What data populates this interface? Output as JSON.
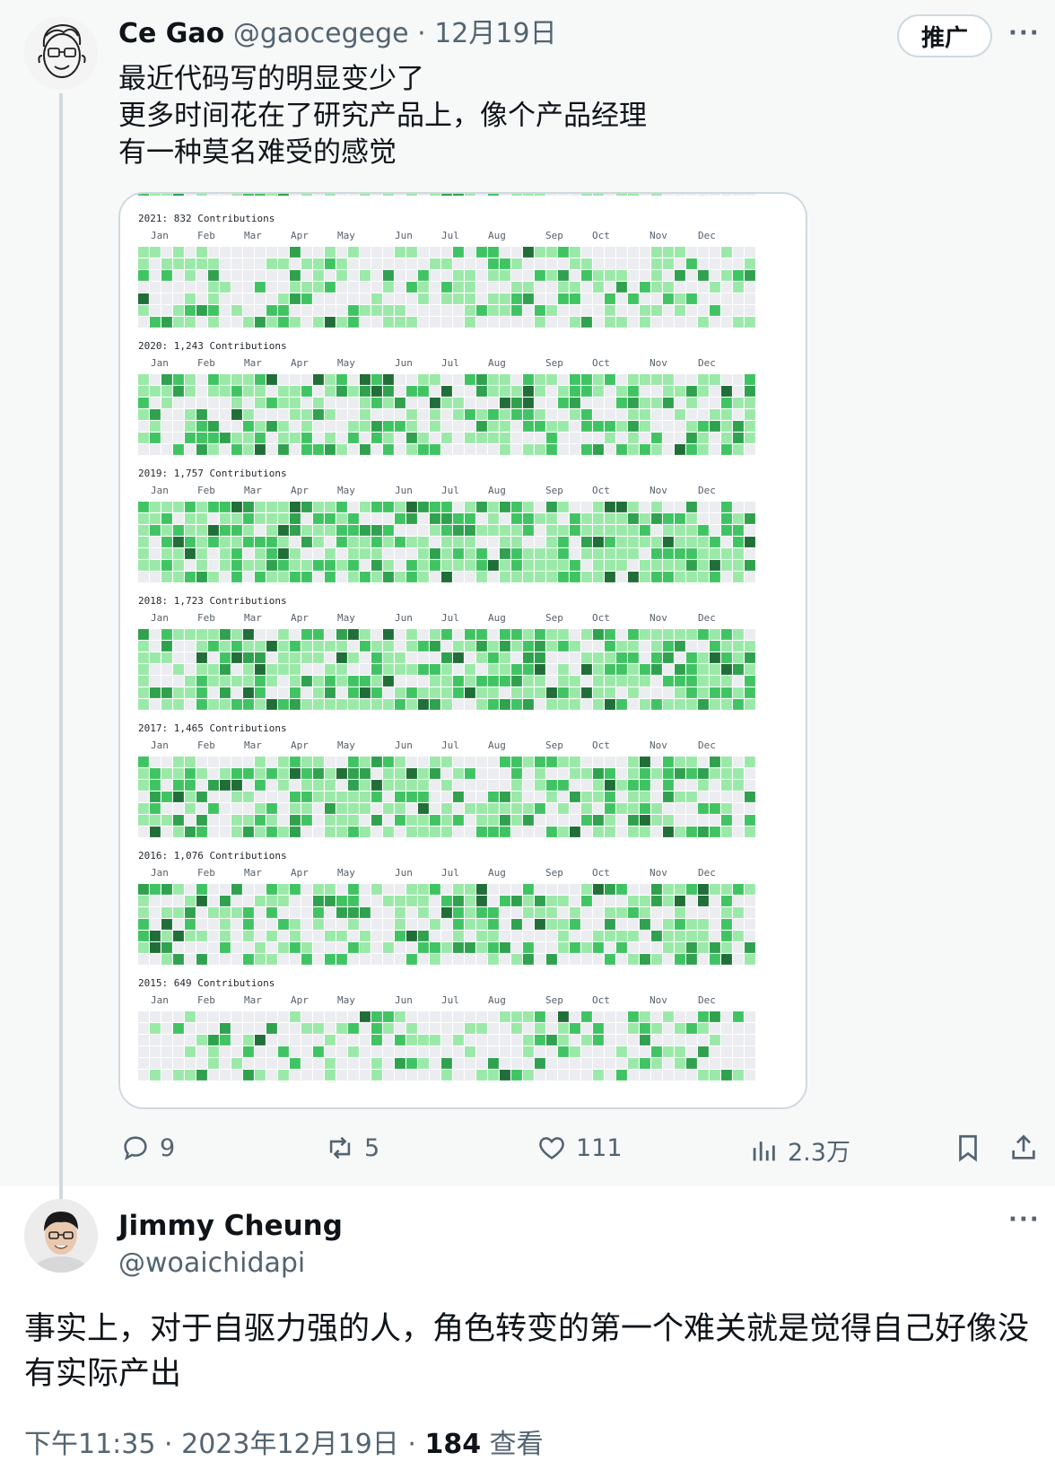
{
  "original_tweet": {
    "author_name": "Ce Gao",
    "author_handle": "@gaocegege",
    "date": "12月19日",
    "promoted_label": "推广",
    "text_lines": [
      "最近代码写的明显变少了",
      "更多时间花在了研究产品上，像个产品经理",
      "有一种莫名难受的感觉"
    ],
    "stats": {
      "replies": "9",
      "retweets": "5",
      "likes": "111",
      "views": "2.3万"
    }
  },
  "reply": {
    "author_name": "Jimmy Cheung",
    "author_handle": "@woaichidapi",
    "text": "事实上，对于自驱力强的人，角色转变的第一个难关就是觉得自己好像没有实际产出",
    "time": "下午11:35",
    "date": "2023年12月19日",
    "views_count": "184",
    "views_label": "查看"
  },
  "contribution_image": {
    "years": [
      {
        "label": "2021: 832 Contributions",
        "months": [
          "Jan",
          "Feb",
          "Mar",
          "Apr",
          "May",
          "Jun",
          "Jul",
          "Aug",
          "Sep",
          "Oct",
          "Nov",
          "Dec"
        ]
      },
      {
        "label": "2020: 1,243 Contributions",
        "months": [
          "Jan",
          "Feb",
          "Mar",
          "Apr",
          "May",
          "Jun",
          "Jul",
          "Aug",
          "Sep",
          "Oct",
          "Nov",
          "Dec"
        ]
      },
      {
        "label": "2019: 1,757 Contributions",
        "months": [
          "Jan",
          "Feb",
          "Mar",
          "Apr",
          "May",
          "Jun",
          "Jul",
          "Aug",
          "Sep",
          "Oct",
          "Nov",
          "Dec"
        ]
      },
      {
        "label": "2018: 1,723 Contributions",
        "months": [
          "Jan",
          "Feb",
          "Mar",
          "Apr",
          "May",
          "Jun",
          "Jul",
          "Aug",
          "Sep",
          "Oct",
          "Nov",
          "Dec"
        ]
      },
      {
        "label": "2017: 1,465 Contributions",
        "months": [
          "Jan",
          "Feb",
          "Mar",
          "Apr",
          "May",
          "Jun",
          "Jul",
          "Aug",
          "Sep",
          "Oct",
          "Nov",
          "Dec"
        ]
      },
      {
        "label": "2016: 1,076 Contributions",
        "months": [
          "Jan",
          "Feb",
          "Mar",
          "Apr",
          "May",
          "Jun",
          "Jul",
          "Aug",
          "Sep",
          "Oct",
          "Nov",
          "Dec"
        ]
      },
      {
        "label": "2015: 649 Contributions",
        "months": [
          "Jan",
          "Feb",
          "Mar",
          "Apr",
          "May",
          "Jun",
          "Jul",
          "Aug",
          "Sep",
          "Oct",
          "Nov",
          "Dec"
        ]
      }
    ],
    "level_colors": [
      "#ebedf0",
      "#9be9a8",
      "#40c463",
      "#30a14e",
      "#216e39"
    ]
  },
  "icons": {
    "reply": "reply-icon",
    "retweet": "retweet-icon",
    "like": "heart-icon",
    "views": "views-chart-icon",
    "bookmark": "bookmark-icon",
    "share": "share-icon",
    "more": "more-options-icon"
  }
}
